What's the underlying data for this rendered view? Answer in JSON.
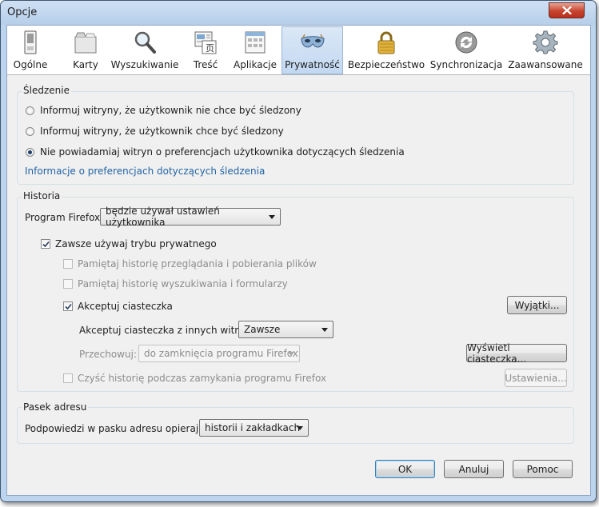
{
  "window": {
    "title": "Opcje"
  },
  "tabs": [
    {
      "label": "Ogólne",
      "icon": "general-icon"
    },
    {
      "label": "Karty",
      "icon": "tabs-icon"
    },
    {
      "label": "Wyszukiwanie",
      "icon": "search-icon"
    },
    {
      "label": "Treść",
      "icon": "content-icon"
    },
    {
      "label": "Aplikacje",
      "icon": "applications-icon"
    },
    {
      "label": "Prywatność",
      "icon": "privacy-mask-icon",
      "selected": true
    },
    {
      "label": "Bezpieczeństwo",
      "icon": "padlock-icon"
    },
    {
      "label": "Synchronizacja",
      "icon": "sync-icon"
    },
    {
      "label": "Zaawansowane",
      "icon": "gear-icon"
    }
  ],
  "tracking": {
    "title": "Śledzenie",
    "options": [
      {
        "label": "Informuj witryny, że użytkownik nie chce być śledzony",
        "selected": false
      },
      {
        "label": "Informuj witryny, że użytkownik chce być śledzony",
        "selected": false
      },
      {
        "label": "Nie powiadamiaj witryn o preferencjach użytkownika dotyczących śledzenia",
        "selected": true
      }
    ],
    "link": "Informacje o preferencjach dotyczących śledzenia"
  },
  "history": {
    "title": "Historia",
    "program_label": "Program Firefox:",
    "program_value": "będzie używał ustawień użytkownika",
    "always_private": {
      "label": "Zawsze używaj trybu prywatnego",
      "checked": true
    },
    "remember_browsing": {
      "label": "Pamiętaj historię przeglądania i pobierania plików",
      "checked": false
    },
    "remember_search": {
      "label": "Pamiętaj historię wyszukiwania i formularzy",
      "checked": false
    },
    "accept_cookies": {
      "label": "Akceptuj ciasteczka",
      "checked": true
    },
    "exceptions_button": "Wyjątki...",
    "third_party_label": "Akceptuj ciasteczka z innych witryn:",
    "third_party_value": "Zawsze",
    "keep_label": "Przechowuj:",
    "keep_value": "do zamknięcia programu Firefox",
    "show_cookies_button": "Wyświetl ciasteczka...",
    "clear_on_close": {
      "label": "Czyść historię podczas zamykania programu Firefox",
      "checked": false
    },
    "settings_button": "Ustawienia..."
  },
  "location_bar": {
    "title": "Pasek adresu",
    "suggest_label": "Podpowiedzi w pasku adresu opieraj na:",
    "suggest_value": "historii i zakładkach"
  },
  "buttons": {
    "ok": "OK",
    "cancel": "Anuluj",
    "help": "Pomoc"
  },
  "colors": {
    "accent": "#2264a5",
    "selected_tab": "#c2d8f1",
    "close_button": "#c7432e"
  }
}
